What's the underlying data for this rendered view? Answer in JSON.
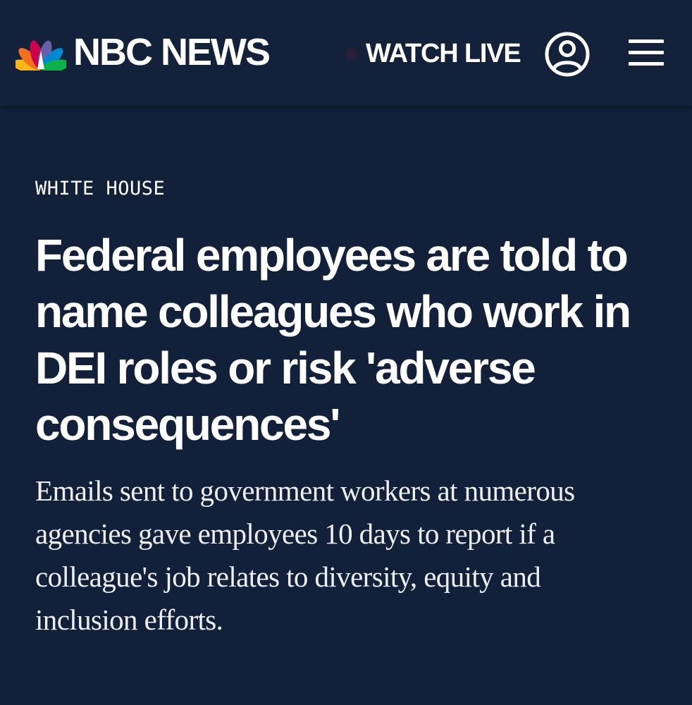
{
  "header": {
    "brand": "NBC NEWS",
    "watch_live": "WATCH LIVE",
    "icons": {
      "logo": "nbc-peacock-icon",
      "account": "user-account-icon",
      "menu": "hamburger-menu-icon"
    }
  },
  "article": {
    "category": "WHITE HOUSE",
    "headline": "Federal employees are told to name colleagues who work in DEI roles or risk 'adverse consequences'",
    "dek": "Emails sent to government workers at numerous agencies gave employees 10 days to report if a colleague's job relates to diversity, equity and inclusion efforts."
  },
  "colors": {
    "background": "#122039",
    "text": "#ffffff",
    "peacock": [
      "#fbb616",
      "#f37021",
      "#cc004c",
      "#6460aa",
      "#0089d0",
      "#0db14b"
    ]
  }
}
